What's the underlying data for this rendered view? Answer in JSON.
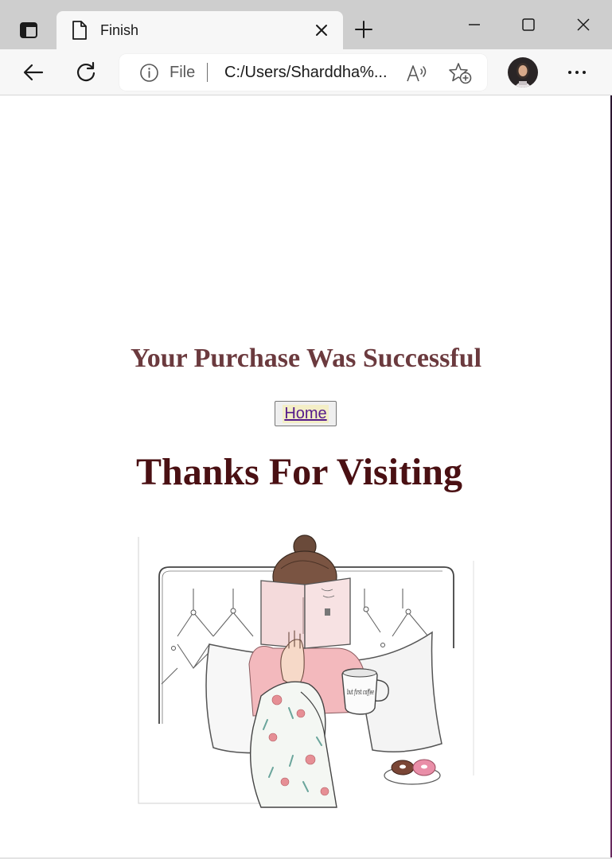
{
  "tab": {
    "title": "Finish"
  },
  "omnibox": {
    "scheme": "File",
    "url": "C:/Users/Sharddha%..."
  },
  "page": {
    "purchase_heading": "Your Purchase Was Successful",
    "home_link": "Home",
    "thanks_heading": "Thanks For Visiting",
    "mug_text": "but first coffee"
  },
  "colors": {
    "purchase_heading": "#6b3a3e",
    "thanks_heading": "#4a1013",
    "link": "#551a8b",
    "tabbar": "#cecece"
  },
  "icons": [
    "tab-actions-icon",
    "page-file-icon",
    "close-icon",
    "new-tab-icon",
    "minimize-icon",
    "maximize-icon",
    "window-close-icon",
    "back-icon",
    "refresh-icon",
    "info-icon",
    "read-aloud-icon",
    "add-favorite-icon",
    "more-icon"
  ]
}
